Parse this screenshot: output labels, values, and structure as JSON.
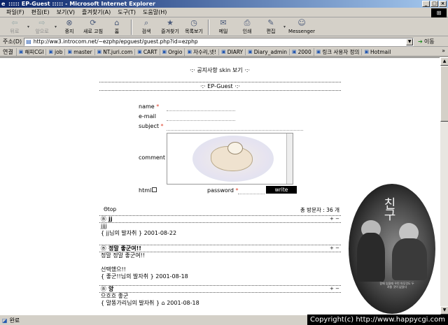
{
  "window": {
    "title": "::::: EP-Guest ::::: - Microsoft Internet Explorer",
    "buttons": [
      "_",
      "□",
      "×"
    ]
  },
  "menu": [
    "파일(F)",
    "편집(E)",
    "보기(V)",
    "즐겨찾기(A)",
    "도구(T)",
    "도움말(H)"
  ],
  "toolbar": {
    "back": "뒤로",
    "forward": "앞으로",
    "stop": "중지",
    "refresh": "새로 고침",
    "home": "홈",
    "search": "검색",
    "favorites": "즐겨찾기",
    "history": "목록보기",
    "mail": "메일",
    "print": "인쇄",
    "edit": "편집",
    "messenger": "Messenger"
  },
  "address": {
    "label": "주소(D)",
    "url": "http://ww3.introcom.net/~ezphp/epguest/guest.php?id=ezphp",
    "go": "이동"
  },
  "links": {
    "label": "연결",
    "items": [
      "해피CGI",
      "job",
      "master",
      "NT.juri.com",
      "CART",
      "Orgio",
      "자수리,넷!",
      "DIARY",
      "Diary_admin",
      "2000",
      "링크 사용자 정의",
      "Hotmail"
    ],
    "more": "»"
  },
  "page": {
    "notice": "·:· 공지사항 skin 보기 ·:·",
    "guest_title": "·:· EP-Guest ·:·",
    "form": {
      "name": "name",
      "email": "e-mail",
      "subject": "subject",
      "comment": "comment",
      "html": "html",
      "password": "password",
      "required_mark": "*",
      "write": "write"
    },
    "list": {
      "top": "Θtop",
      "count": "총 방문자 : 36 개"
    },
    "entries": [
      {
        "name": "jj",
        "body": [
          "jjjj"
        ],
        "author": "{ jj님의 발자취 } 2001-08-22"
      },
      {
        "name": "정말 좋군여!!",
        "body": [
          "정말 정말 좋군여!!",
          "",
          "선택했으!!"
        ],
        "author": "{ 좋군!!님의 발자취 } 2001-08-18"
      },
      {
        "name": "앙",
        "body": [
          "으흐흐 좋군"
        ],
        "author": "{ 말똥가리님의 발자취 } ⌂ 2001-08-18"
      }
    ],
    "poster": {
      "title": "친구",
      "tagline": "함께 있을때 우린 아무것도 두려울 것이 없었다"
    }
  },
  "status": {
    "text": "완료",
    "copyright": "Copyright(c) http://www.happycgi.com"
  }
}
